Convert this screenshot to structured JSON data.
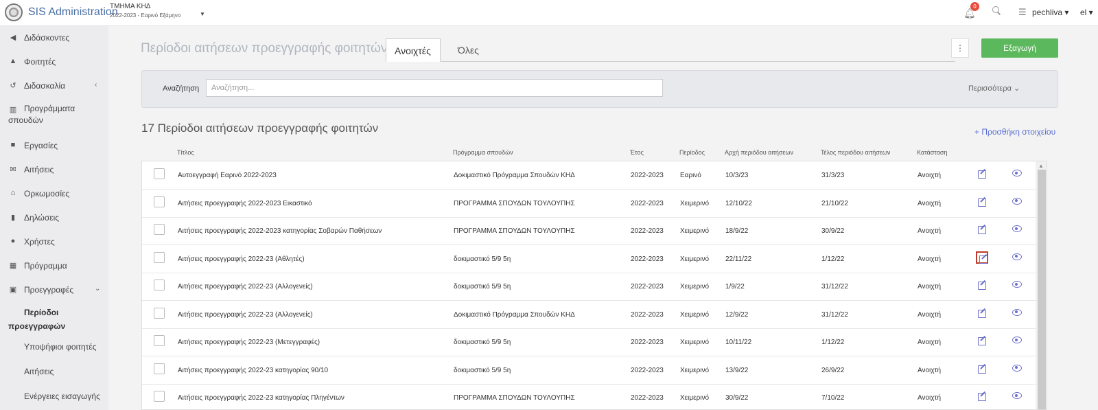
{
  "header": {
    "brand": "SIS Administration",
    "department": "ΤΜΗΜΑ ΚΗΔ",
    "semester": "2022-2023 - Εαρινό Εξάμηνο",
    "notifications_count": "0",
    "user": "pechliva ▾",
    "language": "el ▾"
  },
  "sidebar": {
    "items": [
      {
        "icon": "megaphone-icon",
        "glyph": "◀",
        "label": "Διδάσκοντες"
      },
      {
        "icon": "graduation-cap-icon",
        "glyph": "▲",
        "label": "Φοιτητές"
      },
      {
        "icon": "history-icon",
        "glyph": "↺",
        "label": "Διδασκαλία",
        "arrow": "‹"
      },
      {
        "icon": "bank-icon",
        "glyph": "▥",
        "label": "Προγράμματα",
        "label2": "σπουδών"
      },
      {
        "icon": "briefcase-icon",
        "glyph": "■",
        "label": "Εργασίες"
      },
      {
        "icon": "envelope-icon",
        "glyph": "✉",
        "label": "Αιτήσεις"
      },
      {
        "icon": "oath-icon",
        "glyph": "⌂",
        "label": "Ορκωμοσίες"
      },
      {
        "icon": "clipboard-icon",
        "glyph": "▮",
        "label": "Δηλώσεις"
      },
      {
        "icon": "user-icon",
        "glyph": "●",
        "label": "Χρήστες"
      },
      {
        "icon": "calendar-icon",
        "glyph": "▦",
        "label": "Πρόγραμμα"
      },
      {
        "icon": "id-card-icon",
        "glyph": "▣",
        "label": "Προεγγραφές",
        "arrow": "⌄"
      }
    ],
    "sub_items": [
      {
        "label": "Περίοδοι",
        "label2": "προεγγραφών",
        "active": true
      },
      {
        "label": "Υποψήφιοι φοιτητές"
      },
      {
        "label": "Αιτήσεις"
      },
      {
        "label": "Ενέργειες εισαγωγής"
      }
    ]
  },
  "main": {
    "title": "Περίοδοι αιτήσεων προεγγραφής φοιτητών",
    "tabs": [
      {
        "label": "Ανοιχτές"
      },
      {
        "label": "Όλες"
      }
    ],
    "kebab": "⋮",
    "export_label": "Εξαγωγή",
    "search_label": "Αναζήτηση",
    "search_placeholder": "Αναζήτηση...",
    "more_label": "Περισσότερα ⌄",
    "count_title": "17 Περίοδοι αιτήσεων προεγγραφής φοιτητών",
    "add_label": "+ Προσθήκη στοιχείου"
  },
  "table": {
    "columns": [
      "Τίτλος",
      "Πρόγραμμα σπουδών",
      "Έτος",
      "Περίοδος",
      "Αρχή περιόδου αιτήσεων",
      "Τέλος περιόδου αιτήσεων",
      "Κατάσταση"
    ],
    "rows": [
      [
        "Αυτοεγγραφή Εαρινό 2022-2023",
        "Δοκιμαστικό Πρόγραμμα Σπουδών ΚΗΔ",
        "2022-2023",
        "Εαρινό",
        "10/3/23",
        "31/3/23",
        "Ανοιχτή"
      ],
      [
        "Αιτήσεις προεγγραφής 2022-2023 Εικαστικό",
        "ΠΡΟΓΡΑΜΜΑ ΣΠΟΥΔΩΝ ΤΟΥΛΟΥΠΗΣ",
        "2022-2023",
        "Χειμερινό",
        "12/10/22",
        "21/10/22",
        "Ανοιχτή"
      ],
      [
        "Αιτήσεις προεγγραφής 2022-2023 κατηγορίας Σοβαρών Παθήσεων",
        "ΠΡΟΓΡΑΜΜΑ ΣΠΟΥΔΩΝ ΤΟΥΛΟΥΠΗΣ",
        "2022-2023",
        "Χειμερινό",
        "18/9/22",
        "30/9/22",
        "Ανοιχτή"
      ],
      [
        "Αιτήσεις προεγγραφής 2022-23 (Αθλητές)",
        "δοκιμαστικό 5/9 5η",
        "2022-2023",
        "Χειμερινό",
        "22/11/22",
        "1/12/22",
        "Ανοιχτή"
      ],
      [
        "Αιτήσεις προεγγραφής 2022-23 (Αλλογενείς)",
        "δοκιμαστικό 5/9 5η",
        "2022-2023",
        "Χειμερινό",
        "1/9/22",
        "31/12/22",
        "Ανοιχτή"
      ],
      [
        "Αιτήσεις προεγγραφής 2022-23 (Αλλογενείς)",
        "Δοκιμαστικό Πρόγραμμα Σπουδών ΚΗΔ",
        "2022-2023",
        "Χειμερινό",
        "12/9/22",
        "31/12/22",
        "Ανοιχτή"
      ],
      [
        "Αιτήσεις προεγγραφής 2022-23 (Μετεγγραφές)",
        "δοκιμαστικό 5/9 5η",
        "2022-2023",
        "Χειμερινό",
        "10/11/22",
        "1/12/22",
        "Ανοιχτή"
      ],
      [
        "Αιτήσεις προεγγραφής 2022-23 κατηγορίας 90/10",
        "δοκιμαστικό 5/9 5η",
        "2022-2023",
        "Χειμερινό",
        "13/9/22",
        "26/9/22",
        "Ανοιχτή"
      ],
      [
        "Αιτήσεις προεγγραφής 2022-23 κατηγορίας Πληγέντων",
        "ΠΡΟΓΡΑΜΜΑ ΣΠΟΥΔΩΝ ΤΟΥΛΟΥΠΗΣ",
        "2022-2023",
        "Χειμερινό",
        "30/9/22",
        "7/10/22",
        "Ανοιχτή"
      ]
    ],
    "highlighted_row": 3
  },
  "colors": {
    "brand": "#4a6fa5",
    "accent": "#6b70c9",
    "export": "#5cb85c",
    "badge": "#e74c3c",
    "highlight": "#c0392b"
  }
}
